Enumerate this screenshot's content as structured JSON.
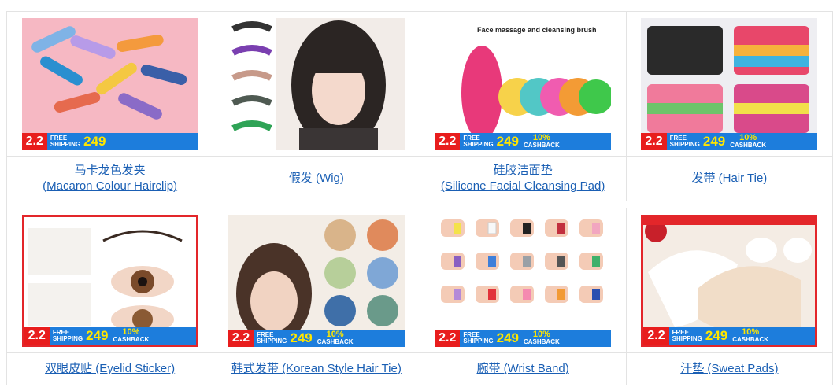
{
  "promo": {
    "badge": "2.2",
    "free_line1": "FREE",
    "free_line2": "SHIPPING",
    "amount": "249",
    "cashback_pct": "10%",
    "cashback_label": "CASHBACK"
  },
  "products": [
    {
      "line1": "马卡龙色发夹",
      "line2": "(Macaron Colour Hairclip)",
      "icon": "hairclip-image",
      "promo": true
    },
    {
      "line1": "假发 (Wig)",
      "line2": "",
      "icon": "wig-image",
      "promo": false
    },
    {
      "line1": "硅胶洁面垫",
      "line2": "(Silicone Facial Cleansing Pad)",
      "icon": "cleansing-pad-image",
      "promo": true,
      "overlay": "Face massage and cleansing brush"
    },
    {
      "line1": "发带 (Hair Tie)",
      "line2": "",
      "icon": "hair-tie-image",
      "promo": true
    },
    {
      "line1": "双眼皮贴 (Eyelid Sticker)",
      "line2": "",
      "icon": "eyelid-sticker-image",
      "promo": true
    },
    {
      "line1": "韩式发带 (Korean Style Hair Tie)",
      "line2": "",
      "icon": "scrunchie-image",
      "promo": true
    },
    {
      "line1": "腕带 (Wrist Band)",
      "line2": "",
      "icon": "wrist-band-image",
      "promo": true
    },
    {
      "line1": "汗垫 (Sweat Pads)",
      "line2": "",
      "icon": "sweat-pads-image",
      "promo": true
    }
  ]
}
